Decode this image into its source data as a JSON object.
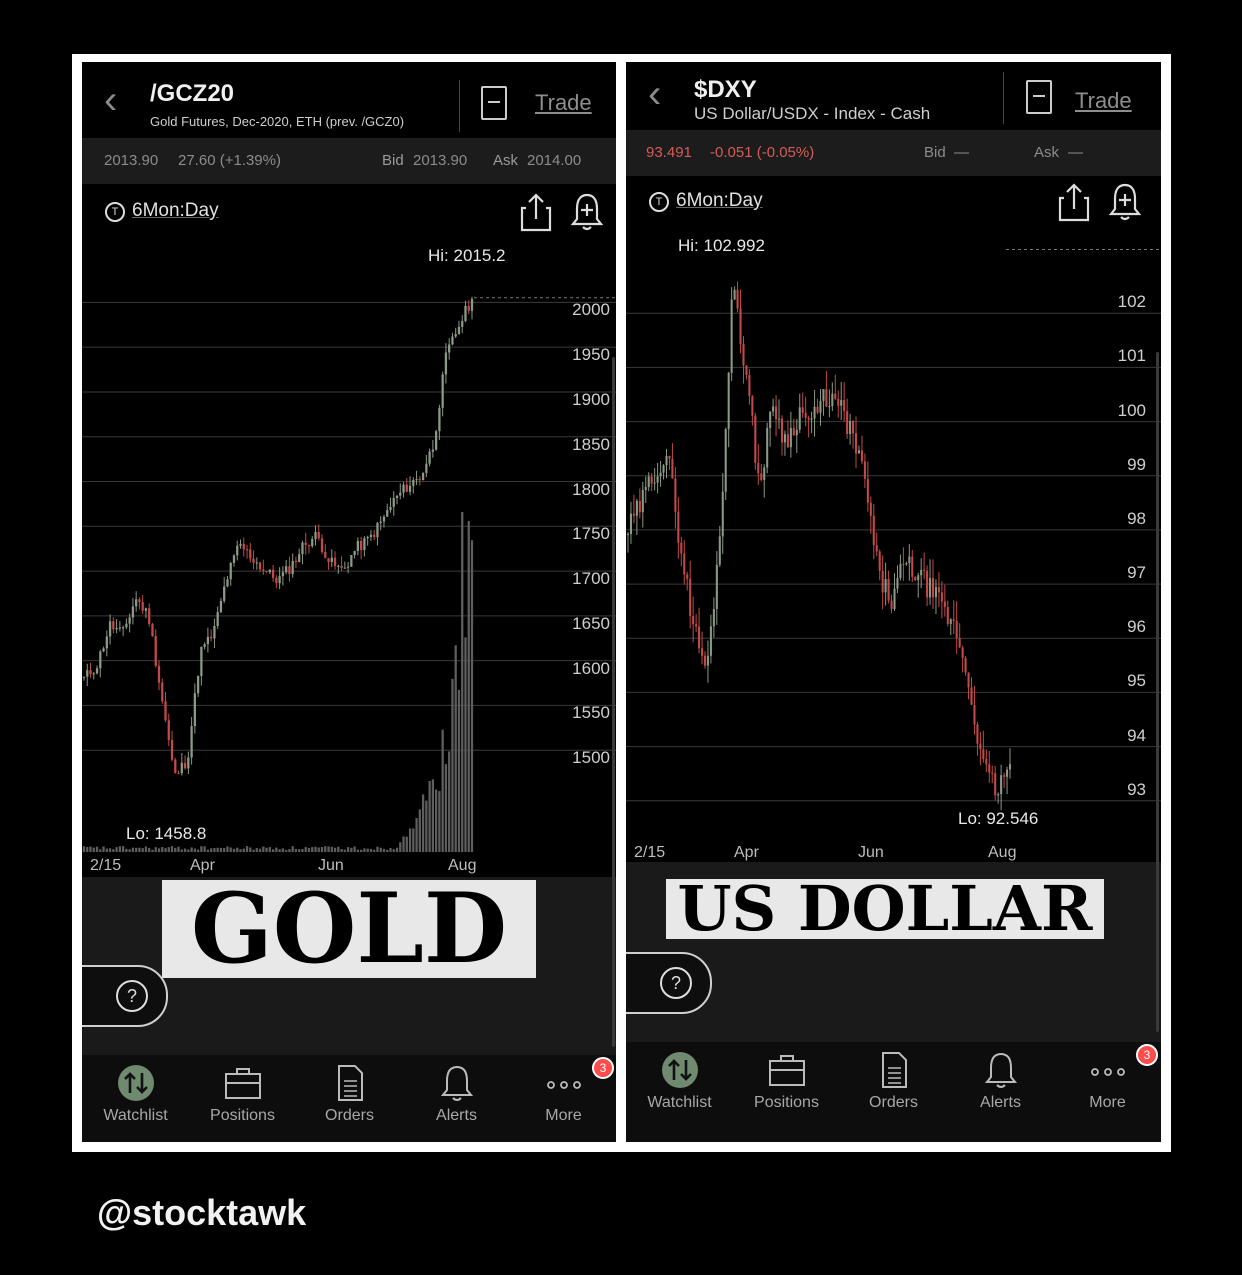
{
  "handle": "@stocktawk",
  "gold": {
    "symbol": "/GCZ20",
    "description": "Gold Futures, Dec-2020, ETH (prev. /GCZ0)",
    "trade_label": "Trade",
    "last": "2013.90",
    "change": "27.60 (+1.39%)",
    "bid_label": "Bid",
    "bid": "2013.90",
    "ask_label": "Ask",
    "ask": "2014.00",
    "timeframe": "6Mon:Day",
    "hi_label": "Hi: 2015.2",
    "lo_label": "Lo: 1458.8",
    "big_label": "GOLD"
  },
  "dxy": {
    "symbol": "$DXY",
    "description": "US Dollar/USDX - Index - Cash",
    "trade_label": "Trade",
    "last": "93.491",
    "change": "-0.051 (-0.05%)",
    "bid_label": "Bid",
    "bid": "—",
    "ask_label": "Ask",
    "ask": "—",
    "timeframe": "6Mon:Day",
    "hi_label": "Hi: 102.992",
    "lo_label": "Lo: 92.546",
    "big_label": "US DOLLAR"
  },
  "nav": {
    "items": [
      "Watchlist",
      "Positions",
      "Orders",
      "Alerts",
      "More"
    ],
    "badge": "3"
  },
  "colors": {
    "bull": "#8a9a86",
    "bear": "#c24a48",
    "background": "#000000",
    "panel": "#1a1a1a"
  },
  "chart_data": [
    {
      "type": "candlestick",
      "title": "/GCZ20",
      "timeframe": "6Mon:Day",
      "x_ticks": [
        "2/15",
        "Apr",
        "Jun",
        "Aug"
      ],
      "y_ticks": [
        2000,
        1950,
        1900,
        1850,
        1800,
        1750,
        1700,
        1650,
        1600,
        1550,
        1500
      ],
      "ylim": [
        1450,
        2025
      ],
      "hi": 2015.2,
      "lo": 1458.8,
      "close_series": {
        "x": [
          "2/15",
          "2/20",
          "2/25",
          "3/2",
          "3/6",
          "3/9",
          "3/12",
          "3/16",
          "3/19",
          "3/23",
          "3/27",
          "4/2",
          "4/8",
          "4/14",
          "4/20",
          "4/27",
          "5/4",
          "5/11",
          "5/18",
          "5/26",
          "6/2",
          "6/9",
          "6/16",
          "6/23",
          "6/30",
          "7/7",
          "7/14",
          "7/21",
          "7/28",
          "8/3",
          "8/6"
        ],
        "values": [
          1590,
          1605,
          1650,
          1640,
          1680,
          1660,
          1570,
          1480,
          1500,
          1620,
          1640,
          1700,
          1740,
          1725,
          1710,
          1700,
          1715,
          1740,
          1750,
          1720,
          1710,
          1735,
          1745,
          1765,
          1790,
          1805,
          1815,
          1850,
          1950,
          1985,
          2014
        ]
      },
      "volume_note": "volume bars spike in late July / August"
    },
    {
      "type": "candlestick",
      "title": "$DXY",
      "timeframe": "6Mon:Day",
      "x_ticks": [
        "2/15",
        "Apr",
        "Jun",
        "Aug"
      ],
      "y_ticks": [
        102,
        101,
        100,
        99,
        98,
        97,
        96,
        95,
        94,
        93
      ],
      "ylim": [
        91.5,
        103.5
      ],
      "hi": 102.992,
      "lo": 92.546,
      "close_series": {
        "x": [
          "2/15",
          "2/20",
          "2/25",
          "3/2",
          "3/9",
          "3/12",
          "3/16",
          "3/19",
          "3/23",
          "3/27",
          "4/2",
          "4/8",
          "4/14",
          "4/20",
          "4/27",
          "5/4",
          "5/11",
          "5/18",
          "5/26",
          "6/2",
          "6/9",
          "6/16",
          "6/23",
          "6/30",
          "7/7",
          "7/14",
          "7/21",
          "7/28",
          "8/3",
          "8/6"
        ],
        "values": [
          97.8,
          98.3,
          98.9,
          99.2,
          97.5,
          96.0,
          95.2,
          97.8,
          102.5,
          100.6,
          98.6,
          100.2,
          99.4,
          100.0,
          99.8,
          100.3,
          100.1,
          99.6,
          98.7,
          97.0,
          96.5,
          97.2,
          97.0,
          96.7,
          96.3,
          95.9,
          94.8,
          93.4,
          93.0,
          93.49
        ]
      }
    }
  ]
}
